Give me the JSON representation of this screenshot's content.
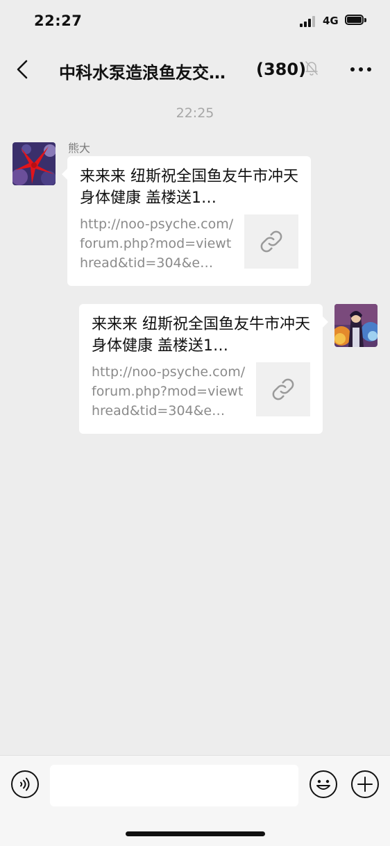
{
  "status_bar": {
    "time": "22:27",
    "network": "4G",
    "icons": [
      "signal-icon",
      "battery-icon"
    ]
  },
  "nav": {
    "title": "中科水泵造浪鱼友交…",
    "member_count": "(380)",
    "icons": [
      "back-icon",
      "mute-icon",
      "more-icon"
    ]
  },
  "chat": {
    "timestamp": "22:25",
    "messages": [
      {
        "sender": "熊大",
        "side": "left",
        "title": "来来来 纽斯祝全国鱼友牛市冲天 身体健康 盖楼送1…",
        "url": "http://noo-psyche.com/forum.php?mod=viewthread&tid=304&e…",
        "thumb_icon": "link-icon"
      },
      {
        "sender": "",
        "side": "right",
        "title": "来来来 纽斯祝全国鱼友牛市冲天 身体健康 盖楼送1…",
        "url": "http://noo-psyche.com/forum.php?mod=viewthread&tid=304&e…",
        "thumb_icon": "link-icon"
      }
    ]
  },
  "input_bar": {
    "value": "",
    "icons": [
      "voice-icon",
      "emoji-icon",
      "plus-icon"
    ]
  },
  "colors": {
    "background": "#ededed",
    "bubble": "#ffffff",
    "muted_text": "#8a8a8a"
  }
}
